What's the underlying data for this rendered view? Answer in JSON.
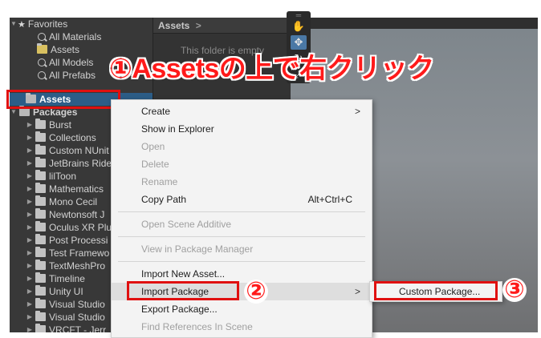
{
  "tree": {
    "favorites_label": "Favorites",
    "favorites": [
      "All Materials",
      "Assets",
      "All Models",
      "All Prefabs"
    ],
    "assets_label": "Assets",
    "packages_label": "Packages",
    "packages": [
      "Burst",
      "Collections",
      "Custom NUnit",
      "JetBrains Ride",
      "lilToon",
      "Mathematics",
      "Mono Cecil",
      "Newtonsoft J",
      "Oculus XR Plu",
      "Post Processi",
      "Test Framewo",
      "TextMeshPro",
      "Timeline",
      "Unity UI",
      "Visual Studio",
      "Visual Studio",
      "VRCFT - Jerr"
    ]
  },
  "assets_panel": {
    "header": "Assets",
    "header_chevron": ">",
    "empty_message": "This folder is empty"
  },
  "annotation": {
    "step1": "①Assetsの上で右クリック",
    "step2": "②",
    "step3": "③",
    "color": "#ff1a1a"
  },
  "context_menu": {
    "create": "Create",
    "show_in_explorer": "Show in Explorer",
    "open": "Open",
    "delete": "Delete",
    "rename": "Rename",
    "copy_path": "Copy Path",
    "copy_path_shortcut": "Alt+Ctrl+C",
    "open_scene_additive": "Open Scene Additive",
    "view_in_package_manager": "View in Package Manager",
    "import_new_asset": "Import New Asset...",
    "import_package": "Import Package",
    "export_package": "Export Package...",
    "find_references": "Find References In Scene",
    "submenu_arrow": ">"
  },
  "submenu": {
    "custom_package": "Custom Package..."
  },
  "colors": {
    "selection": "#2c5d87",
    "highlight_box": "#e01010"
  }
}
